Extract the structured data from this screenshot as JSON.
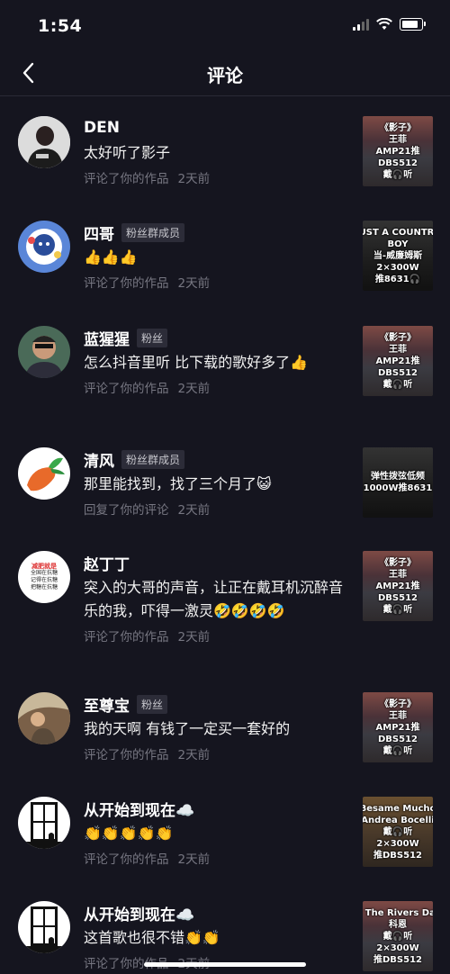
{
  "status_bar": {
    "time": "1:54"
  },
  "nav": {
    "title": "评论"
  },
  "comments": [
    {
      "name": "DEN",
      "badge": "",
      "text": "太好听了影子",
      "action": "评论了你的作品",
      "time": "2天前",
      "thumb_lines": [
        "《影子》",
        "王菲",
        "AMP21推",
        "DBS512",
        "戴🎧听"
      ]
    },
    {
      "name": "四哥",
      "badge": "粉丝群成员",
      "text": "👍👍👍",
      "action": "评论了你的作品",
      "time": "2天前",
      "thumb_lines": [
        "JUST A COUNTRY",
        "BOY",
        "当-威廉姆斯",
        "2×300W",
        "推8631🎧"
      ]
    },
    {
      "name": "蓝猩猩",
      "badge": "粉丝",
      "text": "怎么抖音里听 比下载的歌好多了👍",
      "action": "评论了你的作品",
      "time": "2天前",
      "thumb_lines": [
        "《影子》",
        "王菲",
        "AMP21推",
        "DBS512",
        "戴🎧听"
      ]
    },
    {
      "name": "清风",
      "badge": "粉丝群成员",
      "text": "那里能找到，找了三个月了😺",
      "action": "回复了你的评论",
      "time": "2天前",
      "thumb_lines": [
        "弹性拨弦低频",
        "1000W推8631"
      ]
    },
    {
      "name": "赵丁丁",
      "badge": "",
      "text": "突入的大哥的声音，让正在戴耳机沉醉音乐的我，吓得一激灵🤣🤣🤣🤣",
      "action": "评论了你的作品",
      "time": "2天前",
      "thumb_lines": [
        "《影子》",
        "王菲",
        "AMP21推",
        "DBS512",
        "戴🎧听"
      ]
    },
    {
      "name": "至尊宝",
      "badge": "粉丝",
      "text": "我的天啊 有钱了一定买一套好的",
      "action": "评论了你的作品",
      "time": "2天前",
      "thumb_lines": [
        "《影子》",
        "王菲",
        "AMP21推",
        "DBS512",
        "戴🎧听"
      ]
    },
    {
      "name": "从开始到现在☁️",
      "badge": "",
      "text": "👏👏👏👏👏",
      "action": "评论了你的作品",
      "time": "2天前",
      "thumb_lines": [
        "Besame Mucho",
        "Andrea Bocelli",
        "戴🎧听",
        "2×300W",
        "推DBS512"
      ]
    },
    {
      "name": "从开始到现在☁️",
      "badge": "",
      "text": "这首歌也很不错👏👏",
      "action": "评论了你的作品",
      "time": "2天前",
      "thumb_lines": [
        "dy The Rivers Dark",
        "科恩",
        "戴🎧听",
        "2×300W",
        "推DBS512"
      ]
    }
  ],
  "avatar_5_text": [
    "减肥就是",
    "全国在抗糖",
    "记得在抗糖",
    "把糖在抗糖"
  ],
  "icons": {
    "back": "chevron-left-icon"
  }
}
